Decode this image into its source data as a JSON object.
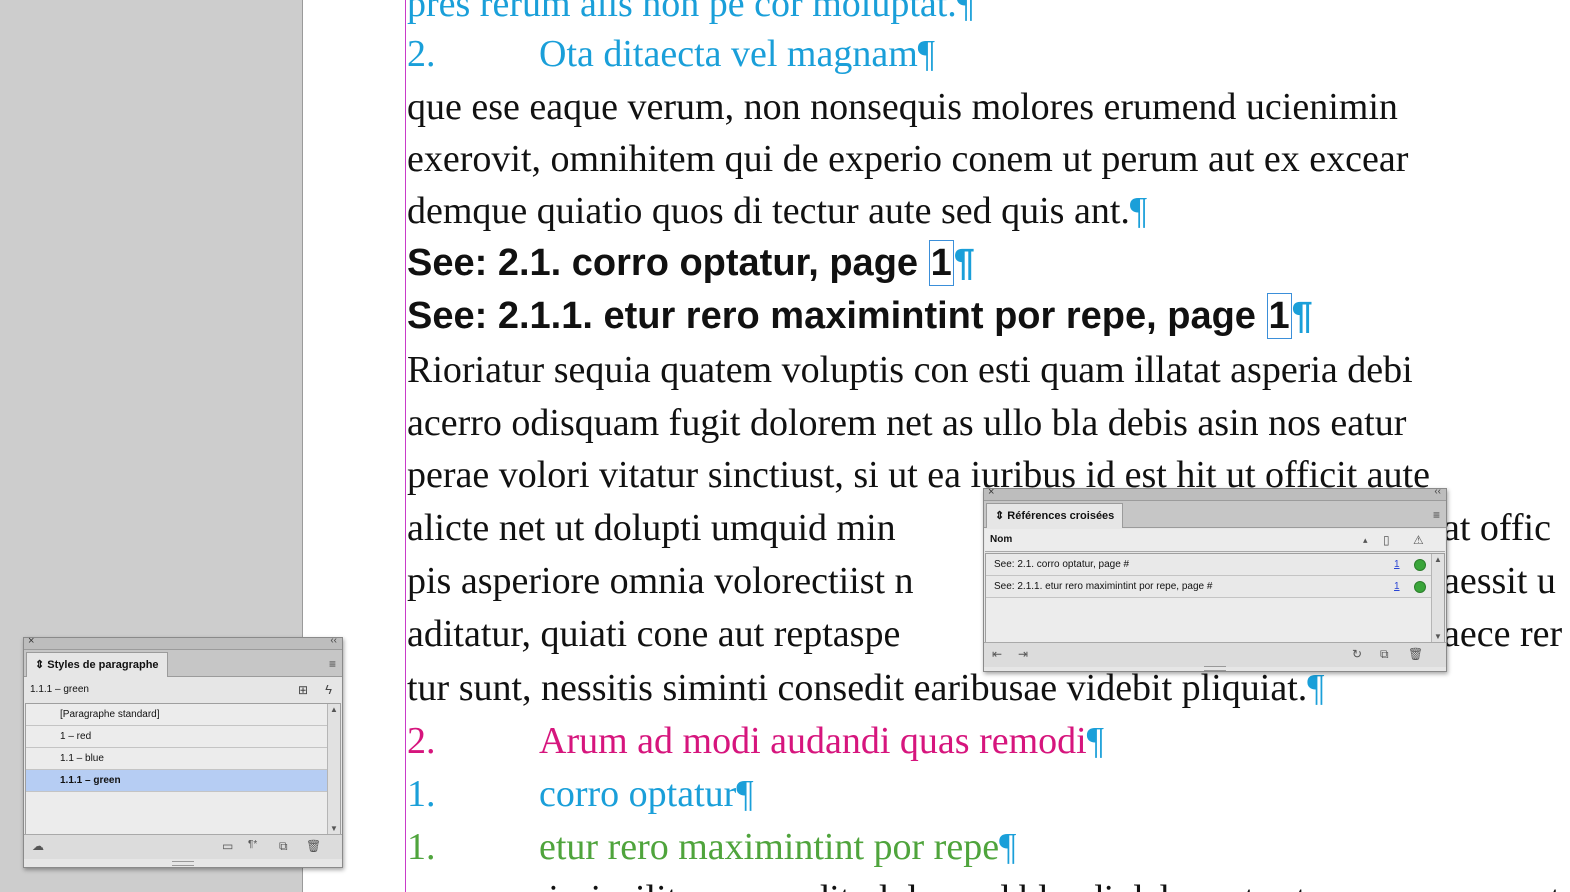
{
  "document": {
    "lines": [
      {
        "text": "pres rerum alis non pe cor moluptat.",
        "style": "cyan"
      },
      {
        "number": "2.",
        "text": "Ota ditaecta vel magnam",
        "style": "cyan"
      },
      {
        "text": "que ese eaque verum, non nonsequis molores erumend ucienimin"
      },
      {
        "text": "exerovit, omnihitem qui de experio conem ut perum aut ex excear"
      },
      {
        "text": "demque quiatio quos di tectur aute sed quis ant."
      },
      {
        "text": "See: 2.1. corro optatur, page ",
        "marker": "1",
        "style": "bold"
      },
      {
        "text": "See: 2.1.1. etur rero maximintint por repe, page ",
        "marker": "1",
        "style": "bold"
      },
      {
        "text": "Rioriatur sequia quatem voluptis con esti quam illatat asperia debi"
      },
      {
        "text": "acerro odisquam fugit dolorem net as ullo bla debis asin nos eatur"
      },
      {
        "text": "perae volori vitatur sinctiust, si ut ea iuribus id est hit ut officit aute"
      },
      {
        "text": "alicte net ut dolupti umquid min",
        "tail": "at offic"
      },
      {
        "text": "pis asperiore omnia volorectiist n",
        "tail": "aessit u"
      },
      {
        "text": "aditatur, quiati cone aut reptaspe",
        "tail": "aece rer"
      },
      {
        "text": "tur sunt, nessitis siminti consedit earibusae videbit pliquiat."
      },
      {
        "number": "2.",
        "text": "Arum ad modi audandi quas remodi",
        "style": "magenta"
      },
      {
        "number": "1.",
        "text": "corro optatur",
        "style": "cyan"
      },
      {
        "number": "1.",
        "text": "etur rero maximintint por repe",
        "style": "green"
      },
      {
        "text": "que num iscipsilit, commodit, dolor sed blandi del, vent est, ex num que optatis"
      }
    ],
    "pilcrow": "¶"
  },
  "paragraph_styles_panel": {
    "close": "×",
    "collapse": "‹‹",
    "tab": "Styles de paragraphe",
    "menu": "≡",
    "current_style": "1.1.1 – green",
    "items": [
      "[Paragraphe standard]",
      "1 – red",
      "1.1 – blue",
      "1.1.1 – green"
    ],
    "selected_index": 3
  },
  "cross_references_panel": {
    "close": "×",
    "collapse": "‹‹",
    "tab": "Références croisées",
    "menu": "≡",
    "column_header": "Nom",
    "rows": [
      {
        "name": "See: 2.1. corro optatur, page #",
        "page": "1",
        "status_color": "#3aa53a"
      },
      {
        "name": "See: 2.1.1. etur rero maximintint por repe, page #",
        "page": "1",
        "status_color": "#3aa53a"
      }
    ]
  },
  "icons": {
    "sort": "▴",
    "new_doc": "▯",
    "warning": "⚠",
    "new_style": "⊞",
    "lightning": "ϟ",
    "folder": "▭",
    "clear_override": "¶*",
    "new": "⧉",
    "trash": "🗑",
    "cloud": "☁",
    "goto_source": "⇤",
    "goto_dest": "⇥",
    "refresh": "↻",
    "create": "⧉"
  }
}
